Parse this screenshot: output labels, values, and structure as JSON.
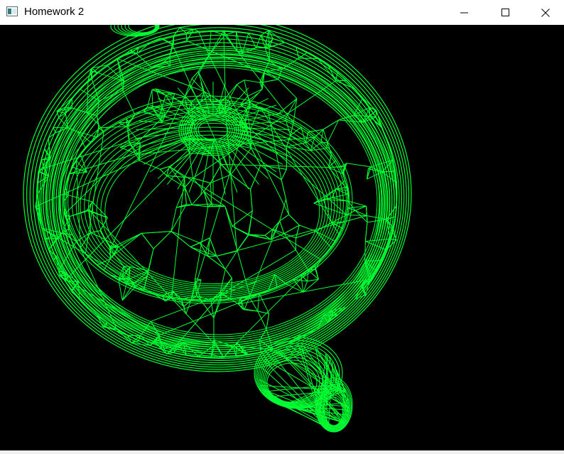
{
  "window": {
    "title": "Homework 2",
    "icon": "app-window-icon",
    "controls": {
      "minimize_icon": "minimize-icon",
      "maximize_icon": "maximize-icon",
      "close_icon": "close-icon"
    }
  },
  "viewport": {
    "background": "#000000",
    "render_mode": "wireframe",
    "wire_color": "#00ff33",
    "object": "teapot"
  }
}
